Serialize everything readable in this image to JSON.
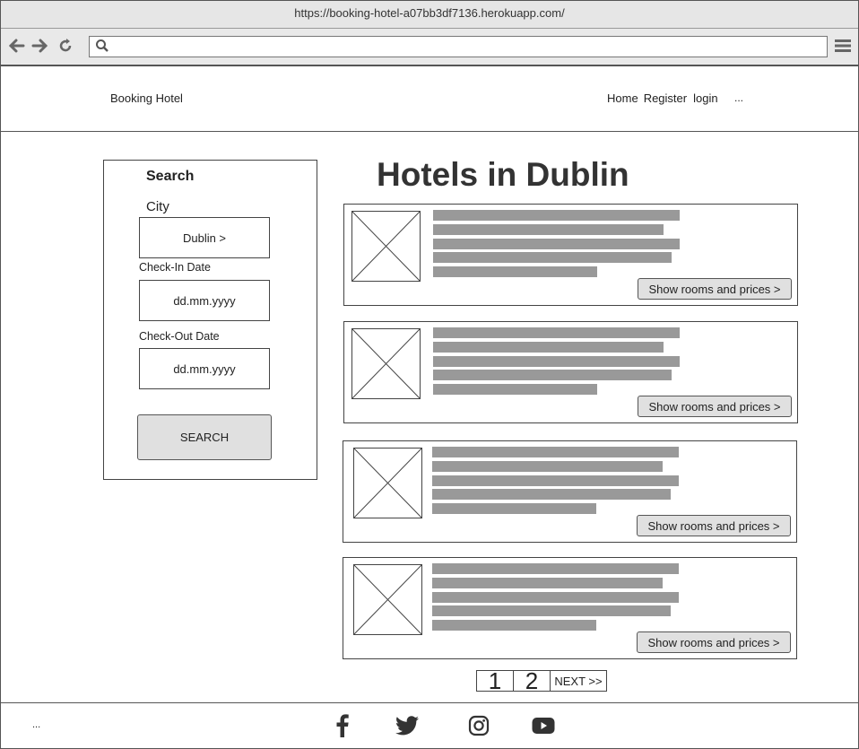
{
  "browser": {
    "url": "https://booking-hotel-a07bb3df7136.herokuapp.com/",
    "address_value": ""
  },
  "header": {
    "brand": "Booking Hotel",
    "nav": [
      "Home",
      "Register",
      "login"
    ],
    "more": "..."
  },
  "search": {
    "title": "Search",
    "city_label": "City",
    "city_value": "Dublin   >",
    "checkin_label": "Check-In Date",
    "checkin_value": "dd.mm.yyyy",
    "checkout_label": "Check-Out Date",
    "checkout_value": "dd.mm.yyyy",
    "button": "SEARCH"
  },
  "main": {
    "heading": "Hotels in Dublin",
    "cards": [
      {
        "button": "Show rooms and prices >"
      },
      {
        "button": "Show rooms and prices >"
      },
      {
        "button": "Show rooms and prices >"
      },
      {
        "button": "Show rooms and prices >"
      }
    ]
  },
  "pagination": {
    "pages": [
      "1",
      "2"
    ],
    "next": "NEXT >>"
  },
  "footer": {
    "more": "...",
    "social_icons": [
      "facebook-icon",
      "twitter-icon",
      "instagram-icon",
      "youtube-icon"
    ]
  }
}
